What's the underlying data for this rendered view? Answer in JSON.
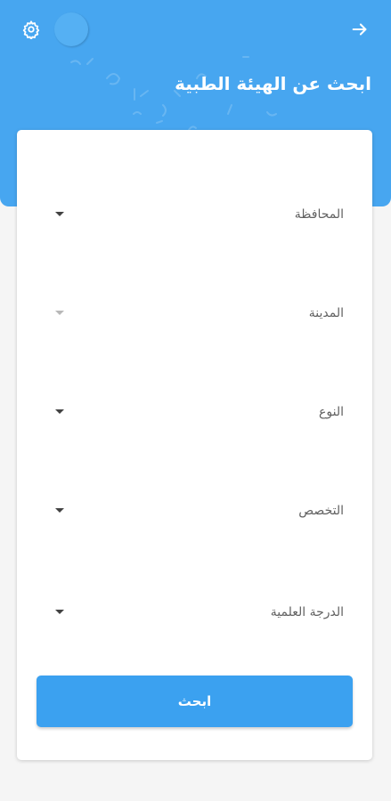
{
  "header": {
    "title": "ابحث عن الهيئة الطبية",
    "settings_icon": "gear-icon",
    "back_icon": "arrow-right-icon",
    "background_color": "#47a6f0"
  },
  "form": {
    "fields": [
      {
        "label": "المحافظة",
        "enabled": true
      },
      {
        "label": "المدينة",
        "enabled": false
      },
      {
        "label": "النوع",
        "enabled": true
      },
      {
        "label": "التخصص",
        "enabled": true
      },
      {
        "label": "الدرجة العلمية",
        "enabled": true
      }
    ],
    "submit_label": "ابحث",
    "submit_color": "#3ba1f0"
  }
}
